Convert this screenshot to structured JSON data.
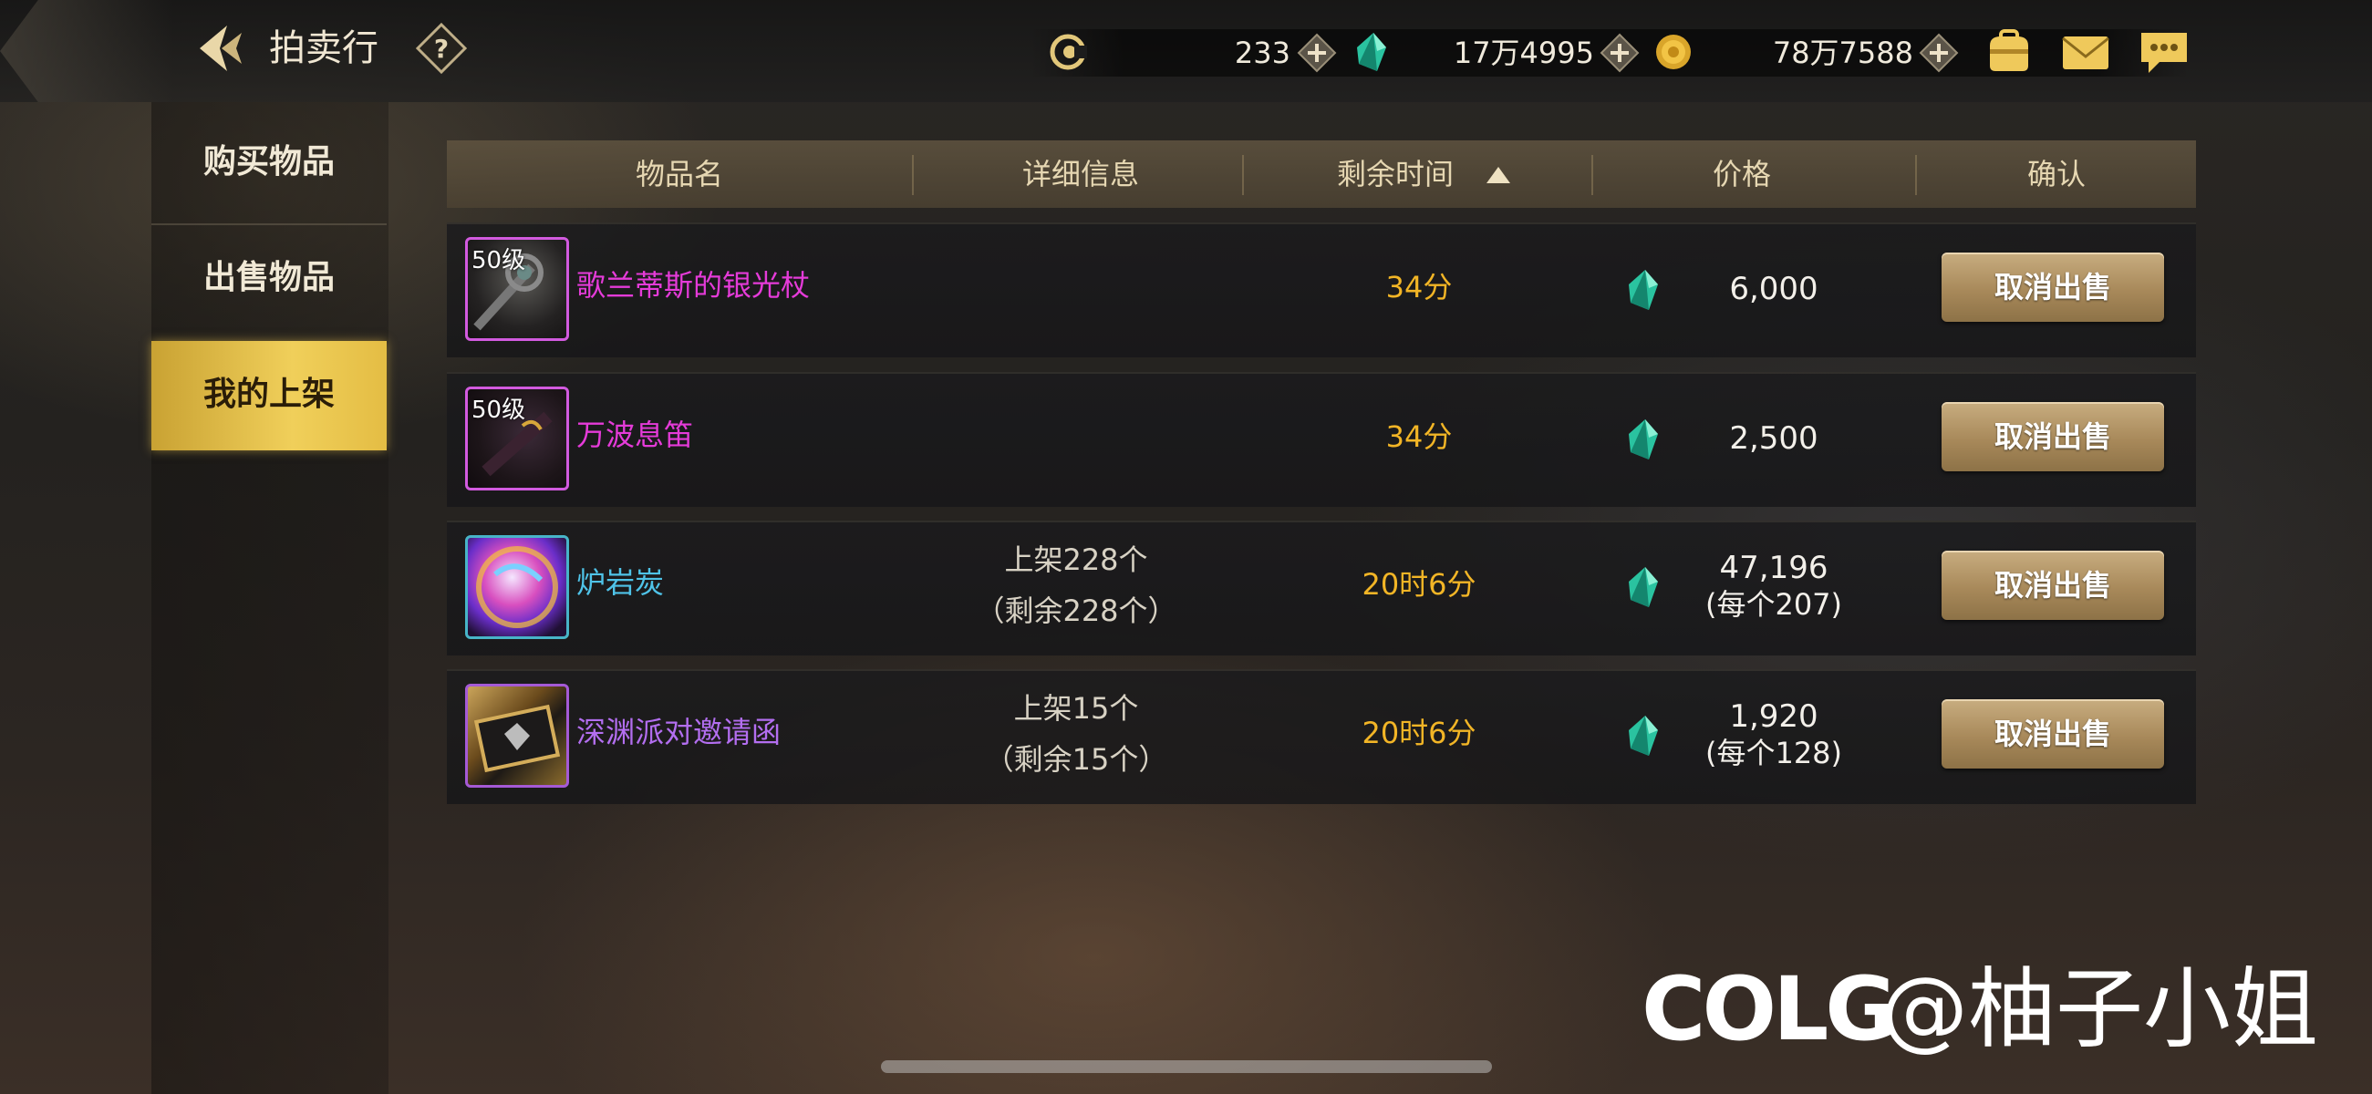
{
  "header": {
    "title": "拍卖行",
    "help_icon": "question-icon",
    "back_icon": "back-arrow-icon"
  },
  "currencies": [
    {
      "name": "coin-c-icon",
      "value": "233"
    },
    {
      "name": "green-gem-icon",
      "value": "17万4995"
    },
    {
      "name": "gold-coin-icon",
      "value": "78万7588"
    }
  ],
  "top_icons": [
    "bag-icon",
    "mail-icon",
    "chat-icon"
  ],
  "sidebar": {
    "items": [
      {
        "label": "购买物品"
      },
      {
        "label": "出售物品"
      },
      {
        "label": "我的上架",
        "active": true
      }
    ]
  },
  "table": {
    "headers": {
      "name": "物品名",
      "detail": "详细信息",
      "time": "剩余时间",
      "price": "价格",
      "confirm": "确认"
    },
    "rows": [
      {
        "level": "50级",
        "name": "歌兰蒂斯的银光杖",
        "name_color": "#e53bd9",
        "detail_line1": "",
        "detail_line2": "",
        "time": "34分",
        "price": "6,000",
        "price_sub": "",
        "button": "取消出售"
      },
      {
        "level": "50级",
        "name": "万波息笛",
        "name_color": "#e53bd9",
        "detail_line1": "",
        "detail_line2": "",
        "time": "34分",
        "price": "2,500",
        "price_sub": "",
        "button": "取消出售"
      },
      {
        "level": "",
        "name": "炉岩炭",
        "name_color": "#4fc3e8",
        "detail_line1": "上架228个",
        "detail_line2": "（剩余228个）",
        "time": "20时6分",
        "price": "47,196",
        "price_sub": "(每个207)",
        "button": "取消出售"
      },
      {
        "level": "",
        "name": "深渊派对邀请函",
        "name_color": "#b36ef0",
        "detail_line1": "上架15个",
        "detail_line2": "（剩余15个）",
        "time": "20时6分",
        "price": "1,920",
        "price_sub": "(每个128)",
        "button": "取消出售"
      }
    ]
  },
  "watermark": {
    "logo": "COLG",
    "user": "@柚子小姐"
  },
  "colors": {
    "accent_gold": "#f0cf5a",
    "time_orange": "#f2b526"
  }
}
